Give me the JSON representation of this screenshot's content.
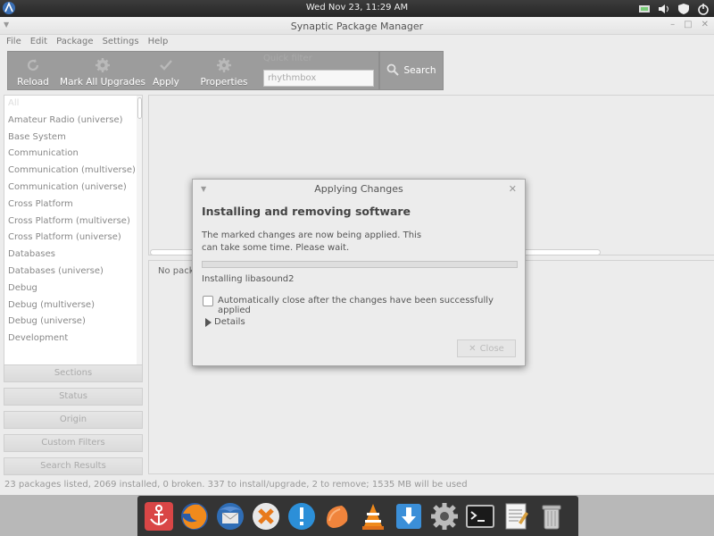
{
  "top_panel": {
    "clock": "Wed Nov 23, 11:29 AM"
  },
  "window": {
    "title": "Synaptic Package Manager",
    "menu": [
      "File",
      "Edit",
      "Package",
      "Settings",
      "Help"
    ]
  },
  "toolbar": {
    "reload_label": "Reload",
    "mark_all_label": "Mark All Upgrades",
    "apply_label": "Apply",
    "properties_label": "Properties",
    "quick_filter_label": "Quick filter",
    "quick_filter_value": "rhythmbox",
    "search_label": "Search"
  },
  "sections": {
    "items": [
      "All",
      "Amateur Radio (universe)",
      "Base System",
      "Communication",
      "Communication (multiverse)",
      "Communication (universe)",
      "Cross Platform",
      "Cross Platform (multiverse)",
      "Cross Platform (universe)",
      "Databases",
      "Databases (universe)",
      "Debug",
      "Debug (multiverse)",
      "Debug (universe)",
      "Development"
    ],
    "buttons": [
      "Sections",
      "Status",
      "Origin",
      "Custom Filters",
      "Search Results"
    ]
  },
  "description": {
    "text": "No pack"
  },
  "status_bar": "23 packages listed, 2069 installed, 0 broken. 337 to install/upgrade, 2 to remove; 1535 MB will be used",
  "dialog": {
    "title": "Applying Changes",
    "heading": "Installing and removing software",
    "message": "The marked changes are now being applied. This can take some time. Please wait.",
    "progress": 0.0,
    "current_action": "Installing libasound2",
    "auto_close_label": "Automatically close after the changes have been successfully applied",
    "auto_close_checked": false,
    "details_label": "Details",
    "close_label": "Close"
  },
  "dock": {
    "items": [
      "anchor-icon",
      "firefox-icon",
      "thunderbird-icon",
      "crossover-icon",
      "notifications-icon",
      "orange-icon",
      "vlc-icon",
      "download-icon",
      "settings-icon",
      "terminal-icon",
      "text-editor-icon",
      "trash-icon"
    ]
  },
  "colors": {
    "toolbar": "#9c9c9c",
    "panel": "#2e2e2e",
    "dock": "#282828"
  }
}
